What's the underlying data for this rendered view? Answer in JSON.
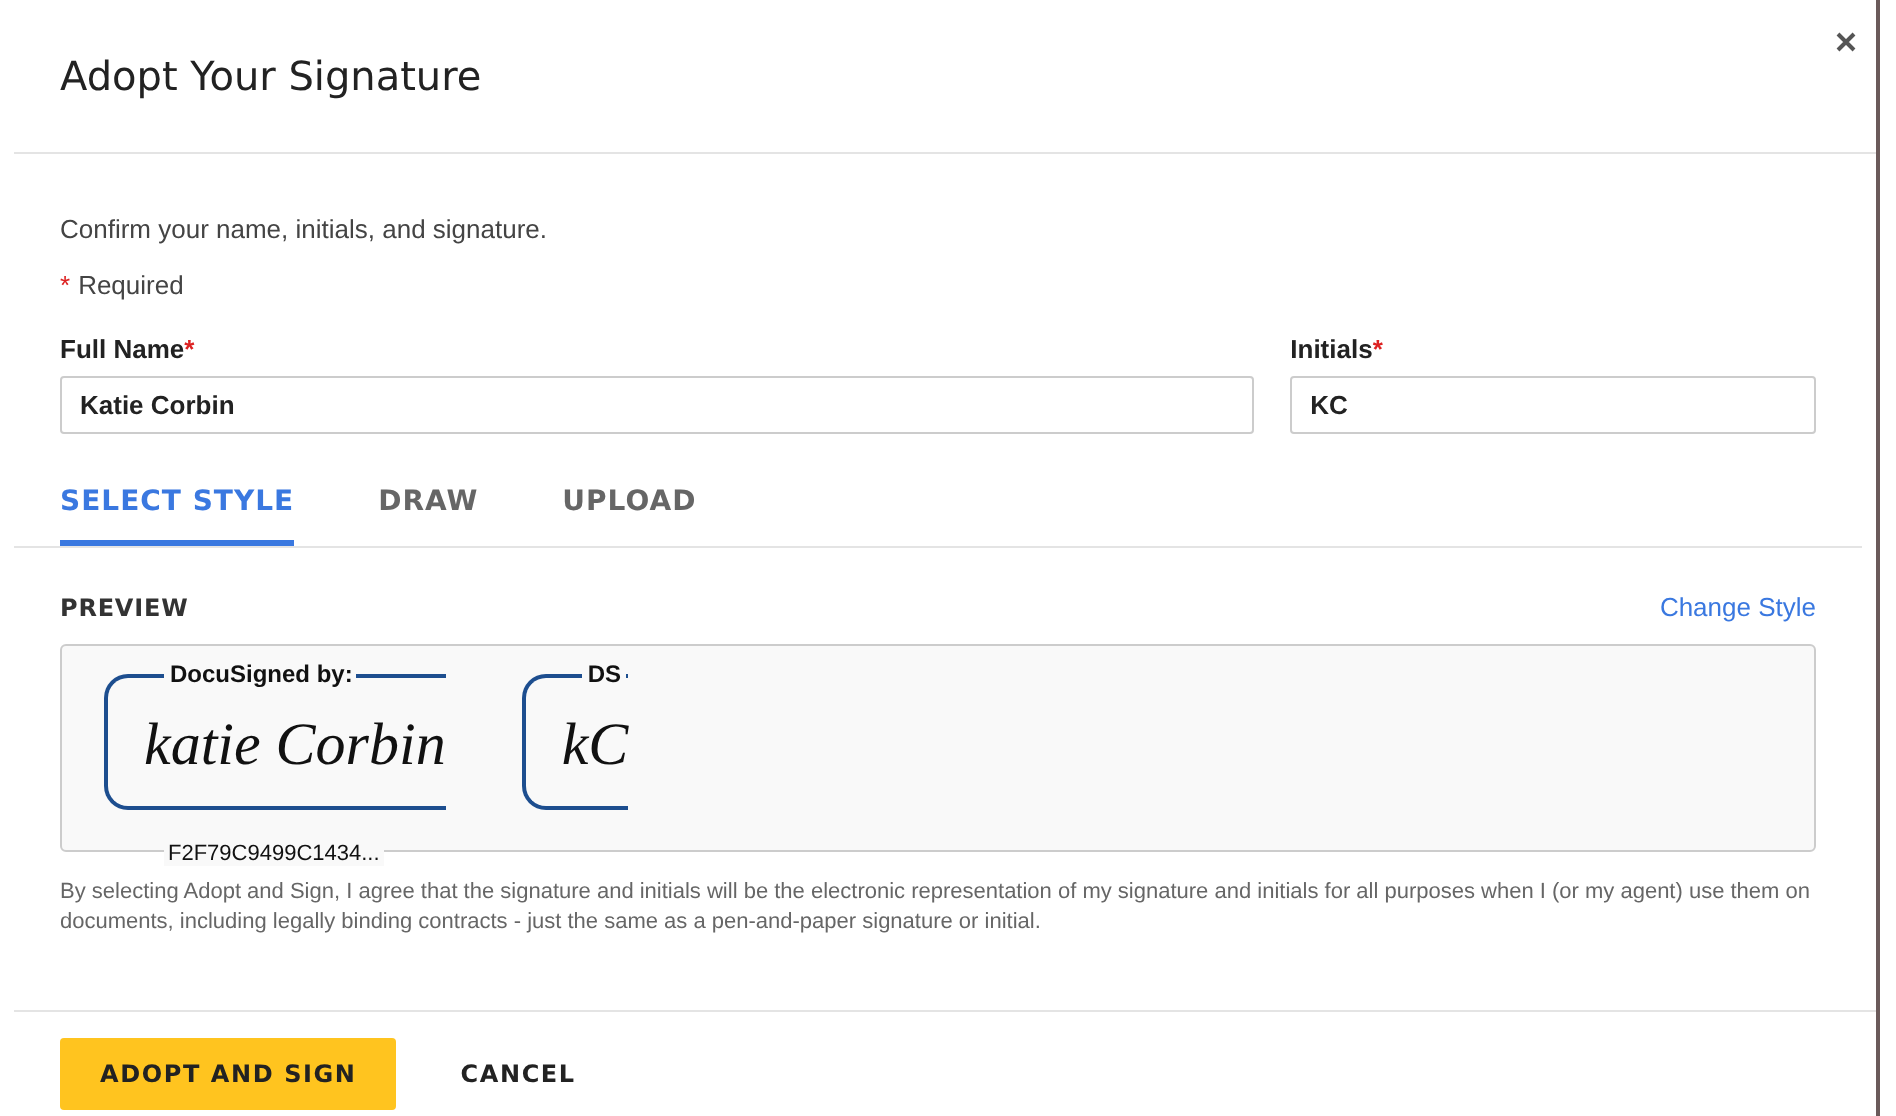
{
  "dialog": {
    "title": "Adopt Your Signature",
    "instruction": "Confirm your name, initials, and signature.",
    "required_mark": "*",
    "required_note": "Required",
    "fields": [
      {
        "label": "Full Name",
        "required": true,
        "value": "Katie Corbin",
        "kind": "wide"
      },
      {
        "label": "Initials",
        "required": true,
        "value": "KC",
        "kind": "narrow"
      }
    ],
    "tabs": [
      {
        "label": "SELECT STYLE",
        "selected": true
      },
      {
        "label": "DRAW",
        "selected": false
      },
      {
        "label": "UPLOAD",
        "selected": false
      }
    ],
    "preview": {
      "label": "PREVIEW",
      "change_style": "Change Style",
      "stamps": [
        {
          "header": "DocuSigned by:",
          "signature": "katie Corbin",
          "id": "F2F79C9499C1434..."
        },
        {
          "header": "DS",
          "signature": "kC"
        }
      ]
    },
    "disclaimer": "By selecting Adopt and Sign, I agree that the signature and initials will be the electronic representation of my signature and initials for all purposes when I (or my agent) use them on documents, including legally binding contracts - just the same as a pen-and-paper signature or initial.",
    "buttons": [
      {
        "label": "ADOPT AND SIGN",
        "kind": "primary"
      },
      {
        "label": "CANCEL",
        "kind": "text"
      }
    ]
  }
}
